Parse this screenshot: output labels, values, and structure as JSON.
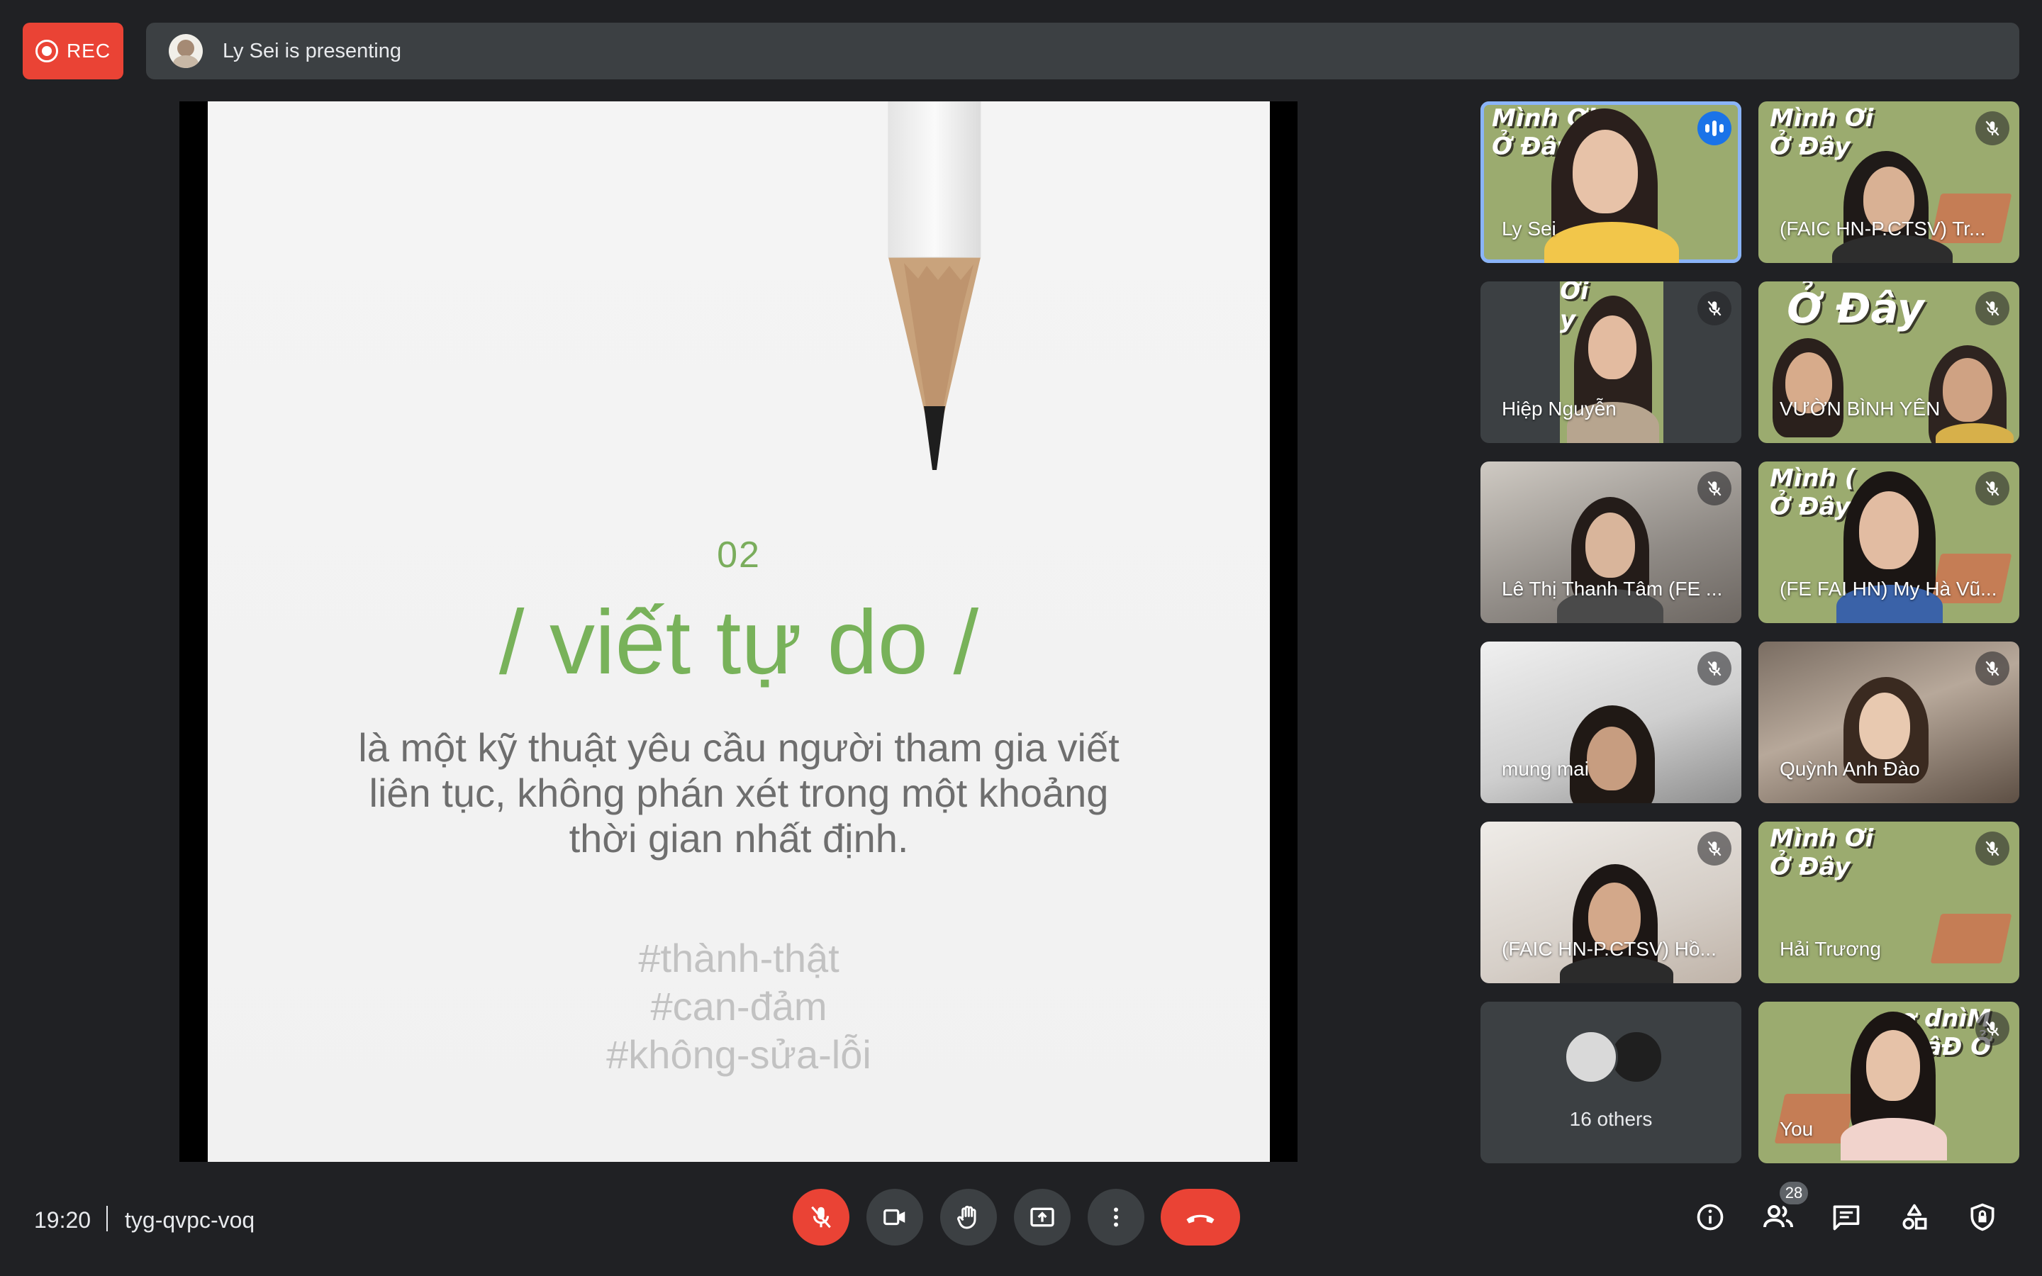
{
  "rec": {
    "label": "REC"
  },
  "presenting": {
    "text": "Ly Sei is presenting"
  },
  "slide": {
    "number": "02",
    "title": "/ viết tự do /",
    "body": "là một kỹ thuật yêu cầu người tham gia viết liên tục, không phán xét trong một khoảng thời gian nhất định.",
    "tags": [
      "#thành-thật",
      "#can-đảm",
      "#không-sửa-lỗi"
    ]
  },
  "participants": [
    {
      "name": "Ly Sei",
      "status": "speaking",
      "banner": "Mình Ơi\nỞ Đây"
    },
    {
      "name": "(FAIC HN-P.CTSV) Tr...",
      "status": "muted",
      "banner": "Mình Ơi\nỞ Đây"
    },
    {
      "name": "Hiệp Nguyễn",
      "status": "muted",
      "banner": "Ơi\ny"
    },
    {
      "name": "VƯỜN BÌNH YÊN",
      "status": "muted",
      "banner": "Ở Đây"
    },
    {
      "name": "Lê Thị Thanh Tâm (FE ...",
      "status": "muted"
    },
    {
      "name": "(FE FAI HN) My Hà Vũ...",
      "status": "muted",
      "banner": "Mình (\nỞ Đây"
    },
    {
      "name": "mung mai",
      "status": "muted"
    },
    {
      "name": "Quỳnh Anh Đào",
      "status": "muted"
    },
    {
      "name": "(FAIC HN-P.CTSV) Hồ...",
      "status": "muted"
    },
    {
      "name": "Hải Trương",
      "status": "muted",
      "banner": "Mình Ơi\nỞ Đây"
    },
    {
      "name": "16 others",
      "status": "group"
    },
    {
      "name": "You",
      "status": "muted",
      "banner": "ơ dnìM\nvâĐ Ở"
    }
  ],
  "meeting": {
    "time": "19:20",
    "code": "tyg-qvpc-voq"
  },
  "controls": {
    "mic": "mic-off-icon",
    "camera": "camera-icon",
    "raise_hand": "hand-icon",
    "present": "present-screen-icon",
    "more": "more-vert-icon",
    "end_call": "end-call-icon"
  },
  "right_panel": {
    "people_count": "28"
  },
  "colors": {
    "background": "#202124",
    "surface": "#3c4043",
    "danger": "#ea4335",
    "active_speaker": "#8ab4f8",
    "slide_accent": "#78b25a"
  }
}
